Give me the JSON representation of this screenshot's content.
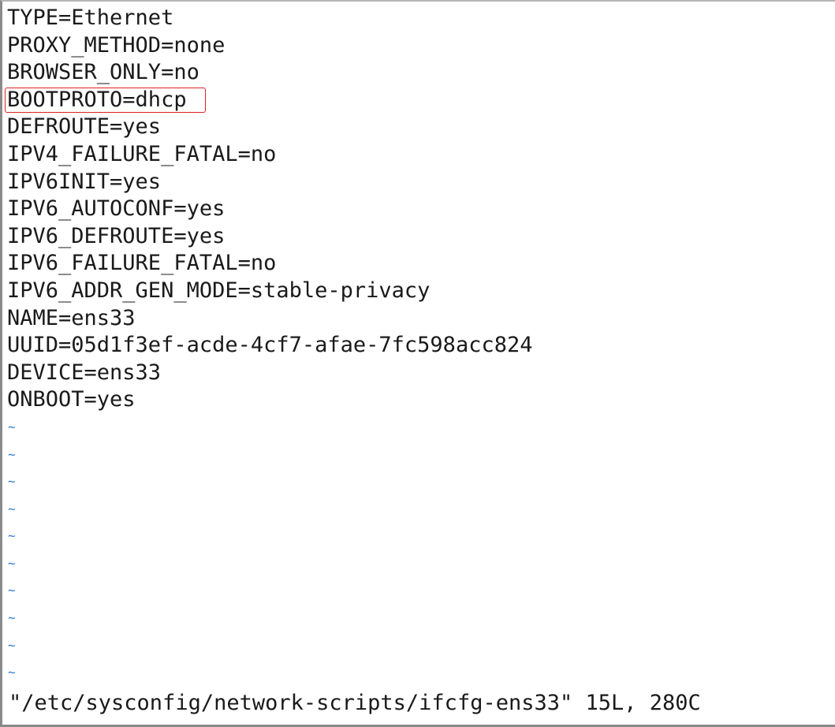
{
  "editor": {
    "lines": [
      "TYPE=Ethernet",
      "PROXY_METHOD=none",
      "BROWSER_ONLY=no",
      "BOOTPROTO=dhcp",
      "DEFROUTE=yes",
      "IPV4_FAILURE_FATAL=no",
      "IPV6INIT=yes",
      "IPV6_AUTOCONF=yes",
      "IPV6_DEFROUTE=yes",
      "IPV6_FAILURE_FATAL=no",
      "IPV6_ADDR_GEN_MODE=stable-privacy",
      "NAME=ens33",
      "UUID=05d1f3ef-acde-4cf7-afae-7fc598acc824",
      "DEVICE=ens33",
      "ONBOOT=yes"
    ],
    "empty_line_marker": "~",
    "highlight_color": "#e02020",
    "tilde_color": "#2e7bd8"
  },
  "status_bar": {
    "message": "\"/etc/sysconfig/network-scripts/ifcfg-ens33\" 15L, 280C"
  }
}
